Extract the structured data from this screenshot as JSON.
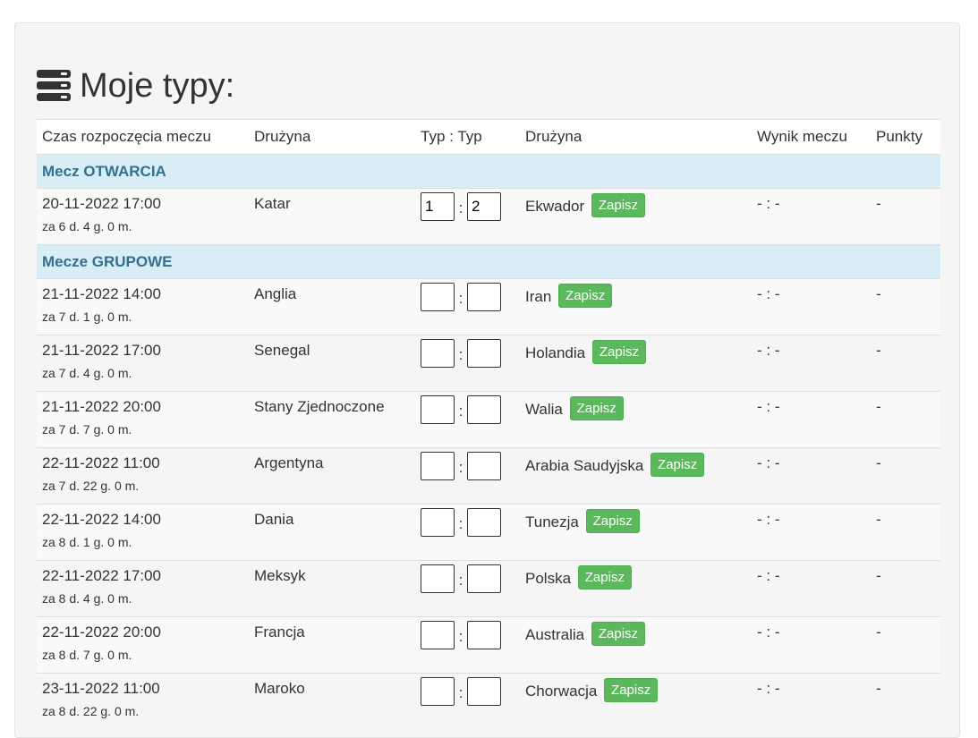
{
  "page": {
    "title": "Moje typy:",
    "icon": "database-icon"
  },
  "table": {
    "headers": [
      "Czas rozpoczęcia meczu",
      "Drużyna",
      "Typ : Typ",
      "Drużyna",
      "Wynik meczu",
      "Punkty"
    ],
    "save_label": "Zapisz",
    "score_separator": ":",
    "groups": [
      {
        "name": "Mecz OTWARCIA",
        "matches": [
          {
            "time": "20-11-2022 17:00",
            "countdown": "za 6 d. 4 g. 0 m.",
            "home": "Katar",
            "tip_home": "1",
            "tip_away": "2",
            "away": "Ekwador",
            "result": "- : -",
            "points": "-"
          }
        ]
      },
      {
        "name": "Mecze GRUPOWE",
        "matches": [
          {
            "time": "21-11-2022 14:00",
            "countdown": "za 7 d. 1 g. 0 m.",
            "home": "Anglia",
            "tip_home": "",
            "tip_away": "",
            "away": "Iran",
            "result": "- : -",
            "points": "-"
          },
          {
            "time": "21-11-2022 17:00",
            "countdown": "za 7 d. 4 g. 0 m.",
            "home": "Senegal",
            "tip_home": "",
            "tip_away": "",
            "away": "Holandia",
            "result": "- : -",
            "points": "-"
          },
          {
            "time": "21-11-2022 20:00",
            "countdown": "za 7 d. 7 g. 0 m.",
            "home": "Stany Zjednoczone",
            "tip_home": "",
            "tip_away": "",
            "away": "Walia",
            "result": "- : -",
            "points": "-"
          },
          {
            "time": "22-11-2022 11:00",
            "countdown": "za 7 d. 22 g. 0 m.",
            "home": "Argentyna",
            "tip_home": "",
            "tip_away": "",
            "away": "Arabia Saudyjska",
            "result": "- : -",
            "points": "-"
          },
          {
            "time": "22-11-2022 14:00",
            "countdown": "za 8 d. 1 g. 0 m.",
            "home": "Dania",
            "tip_home": "",
            "tip_away": "",
            "away": "Tunezja",
            "result": "- : -",
            "points": "-"
          },
          {
            "time": "22-11-2022 17:00",
            "countdown": "za 8 d. 4 g. 0 m.",
            "home": "Meksyk",
            "tip_home": "",
            "tip_away": "",
            "away": "Polska",
            "result": "- : -",
            "points": "-"
          },
          {
            "time": "22-11-2022 20:00",
            "countdown": "za 8 d. 7 g. 0 m.",
            "home": "Francja",
            "tip_home": "",
            "tip_away": "",
            "away": "Australia",
            "result": "- : -",
            "points": "-"
          },
          {
            "time": "23-11-2022 11:00",
            "countdown": "za 8 d. 22 g. 0 m.",
            "home": "Maroko",
            "tip_home": "",
            "tip_away": "",
            "away": "Chorwacja",
            "result": "- : -",
            "points": "-"
          }
        ]
      }
    ]
  }
}
